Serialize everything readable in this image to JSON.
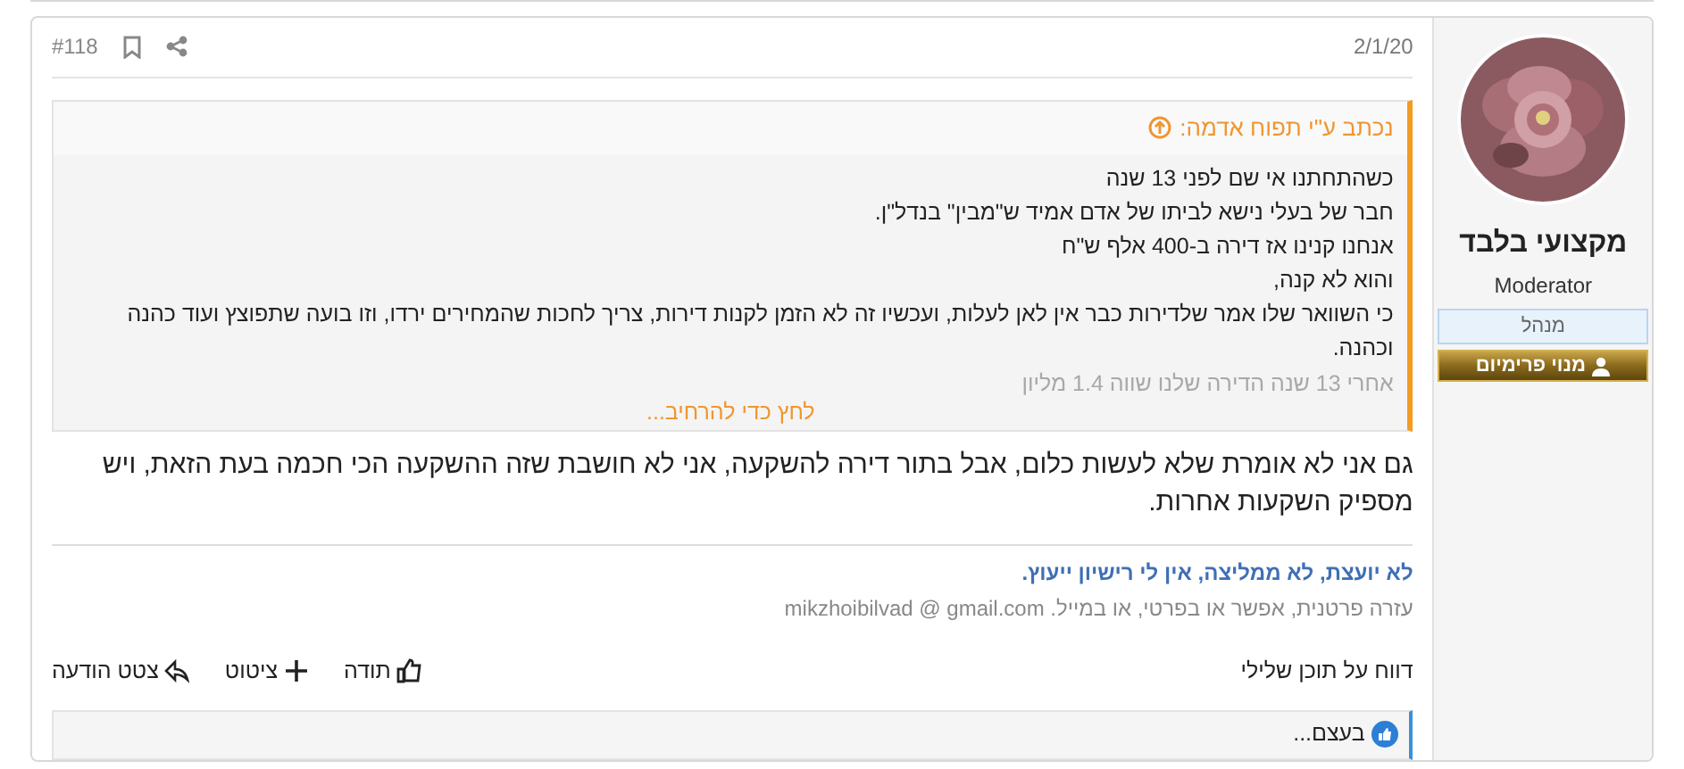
{
  "post": {
    "number": "#118",
    "date": "2/1/20"
  },
  "author": {
    "name": "מקצועי בלבד",
    "title": "Moderator",
    "badges": [
      {
        "kind": "role",
        "label": "מנהל"
      },
      {
        "kind": "premium",
        "label": "מנוי פרימיום"
      }
    ]
  },
  "quote": {
    "attribution": "נכתב ע\"י תפוח אדמה:",
    "lines": [
      "כשהתחתנו אי שם לפני 13 שנה",
      "חבר של בעלי נישא לביתו של אדם אמיד ש\"מבין\" בנדל\"ן.",
      "אנחנו קנינו אז דירה ב-400 אלף ש\"ח",
      "והוא לא קנה,",
      "כי השוואר שלו אמר שלדירות כבר אין לאן לעלות, ועכשיו זה לא הזמן לקנות דירות, צריך לחכות שהמחירים ירדו, וזו בועה שתפוצץ ועוד כהנה וכהנה."
    ],
    "faded_line": "אחרי 13 שנה הדירה שלנו שווה 1.4 מליון",
    "expand_link": "לחץ כדי להרחיב..."
  },
  "body": "גם אני לא אומרת שלא לעשות כלום, אבל בתור דירה להשקעה, אני לא חושבת שזה ההשקעה הכי חכמה בעת הזאת, ויש מספיק השקעות אחרות.",
  "signature": {
    "headline": "לא יועצת, לא ממליצה, אין לי רישיון ייעוץ.",
    "contact": "עזרה פרטנית, אפשר או בפרטי, או במייל. mikzhoibilvad @ gmail.com"
  },
  "actions": {
    "report": "דווח על תוכן שלילי",
    "buttons": [
      {
        "kind": "like",
        "label": "תודה"
      },
      {
        "kind": "quote",
        "label": "ציטוט"
      },
      {
        "kind": "reply",
        "label": "צטט הודעה"
      }
    ]
  },
  "reactions": {
    "summary": "בעצם..."
  }
}
